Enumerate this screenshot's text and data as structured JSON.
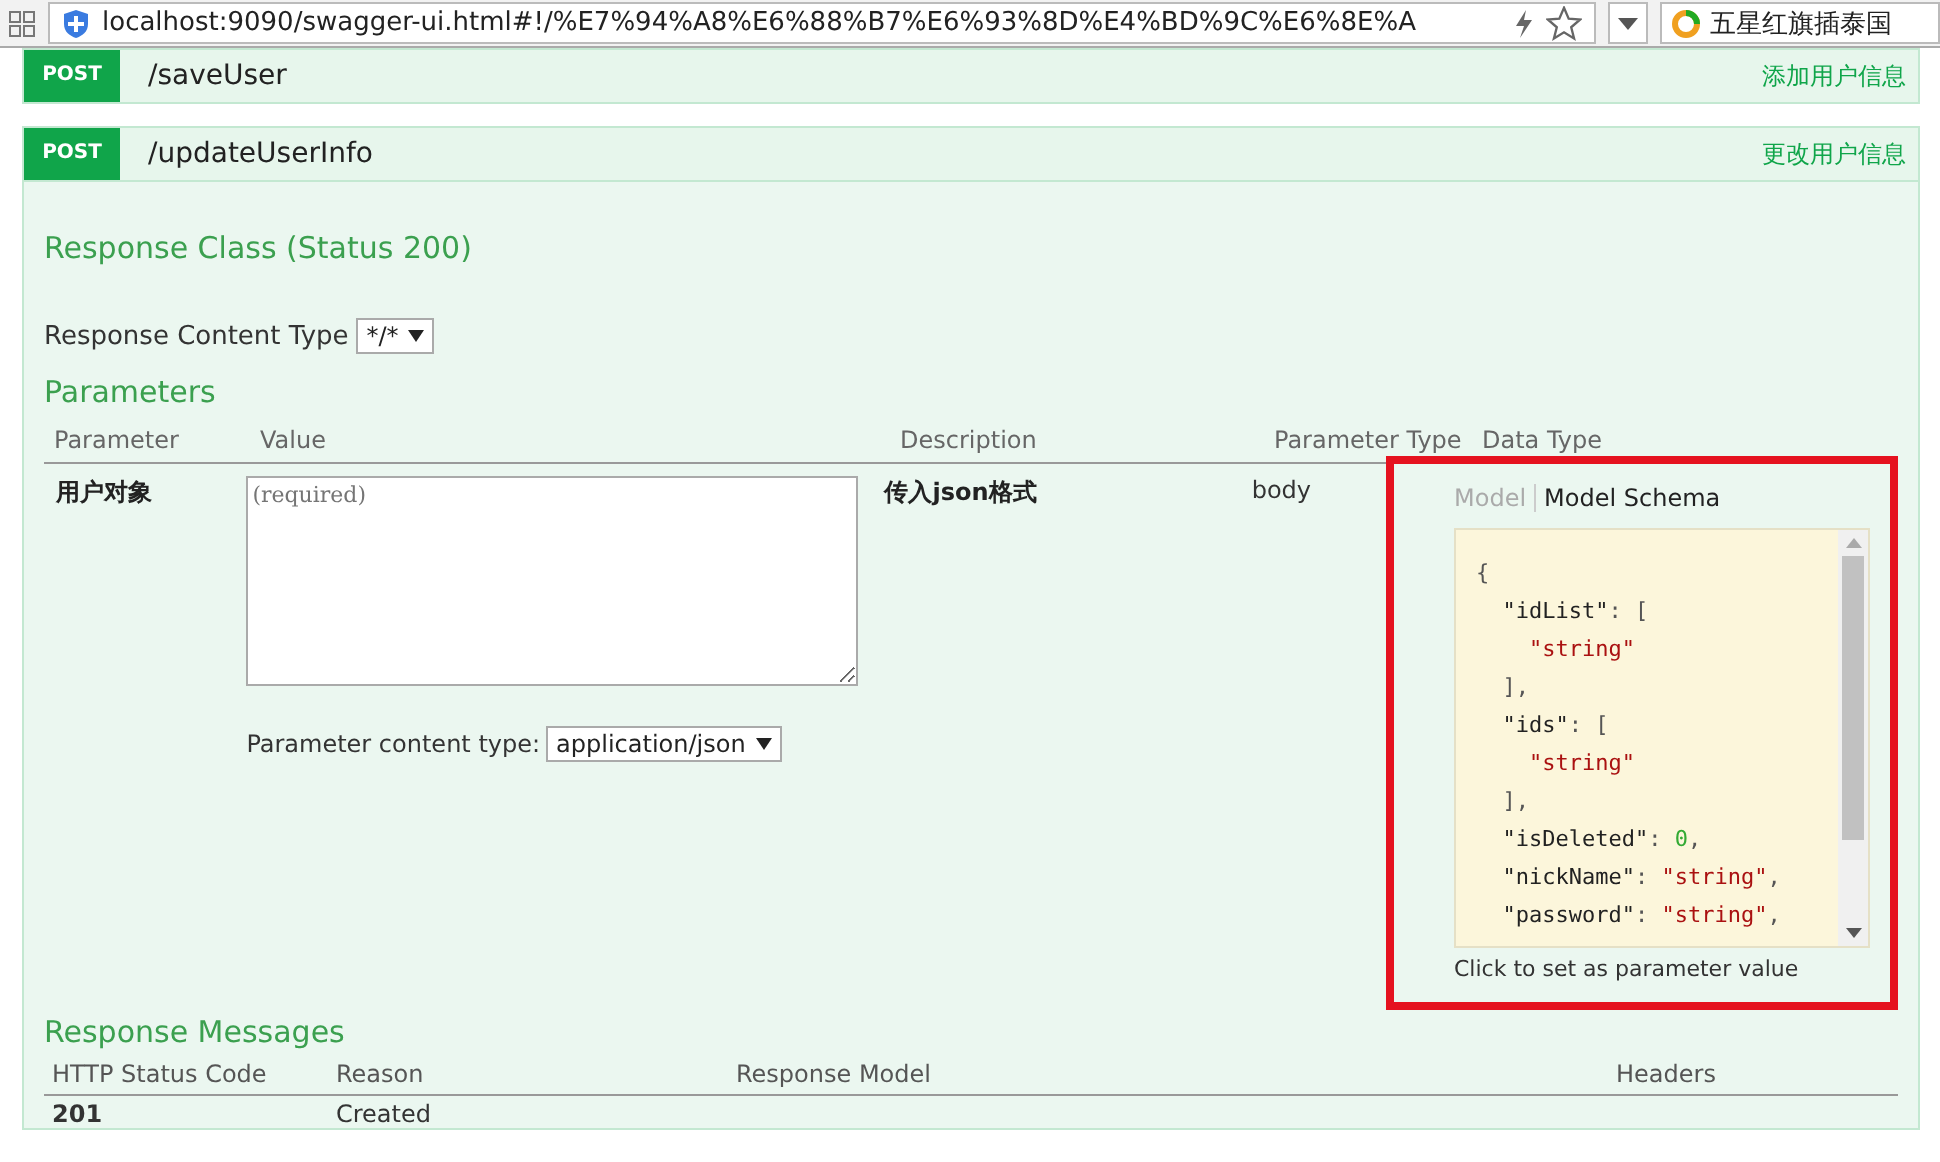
{
  "address_bar": {
    "url": "localhost:9090/swagger-ui.html#!/%E7%94%A8%E6%88%B7%E6%93%8D%E4%BD%9C%E6%8E%A",
    "search_text": "五星红旗插泰国"
  },
  "operations": [
    {
      "method": "POST",
      "path": "/saveUser",
      "summary": "添加用户信息",
      "expanded": false
    },
    {
      "method": "POST",
      "path": "/updateUserInfo",
      "summary": "更改用户信息",
      "expanded": true
    }
  ],
  "response_class": {
    "title": "Response Class (Status 200)"
  },
  "response_content_type": {
    "label": "Response Content Type",
    "value": "*/*"
  },
  "parameters": {
    "title": "Parameters",
    "columns": [
      "Parameter",
      "Value",
      "Description",
      "Parameter Type",
      "Data Type"
    ],
    "rows": [
      {
        "name": "用户对象",
        "placeholder": "(required)",
        "content_type_label": "Parameter content type:",
        "content_type": "application/json",
        "description": "传入json格式",
        "parameter_type": "body",
        "model_tabs": [
          {
            "label": "Model",
            "selected": false
          },
          {
            "label": "Model Schema",
            "selected": true
          }
        ],
        "schema_lines": [
          {
            "tokens": [
              {
                "kind": "punct",
                "text": "{"
              }
            ],
            "children": [
              {
                "tokens": [
                  {
                    "kind": "key",
                    "text": "\"idList\""
                  },
                  {
                    "kind": "punct",
                    "text": ": ["
                  }
                ],
                "children": [
                  {
                    "tokens": [
                      {
                        "kind": "string",
                        "text": "\"string\""
                      }
                    ]
                  }
                ]
              },
              {
                "tokens": [
                  {
                    "kind": "punct",
                    "text": "],"
                  }
                ]
              },
              {
                "tokens": [
                  {
                    "kind": "key",
                    "text": "\"ids\""
                  },
                  {
                    "kind": "punct",
                    "text": ": ["
                  }
                ],
                "children": [
                  {
                    "tokens": [
                      {
                        "kind": "string",
                        "text": "\"string\""
                      }
                    ]
                  }
                ]
              },
              {
                "tokens": [
                  {
                    "kind": "punct",
                    "text": "],"
                  }
                ]
              },
              {
                "tokens": [
                  {
                    "kind": "key",
                    "text": "\"isDeleted\""
                  },
                  {
                    "kind": "punct",
                    "text": ": "
                  },
                  {
                    "kind": "number",
                    "text": "0"
                  },
                  {
                    "kind": "punct",
                    "text": ","
                  }
                ]
              },
              {
                "tokens": [
                  {
                    "kind": "key",
                    "text": "\"nickName\""
                  },
                  {
                    "kind": "punct",
                    "text": ": "
                  },
                  {
                    "kind": "string",
                    "text": "\"string\""
                  },
                  {
                    "kind": "punct",
                    "text": ","
                  }
                ]
              },
              {
                "tokens": [
                  {
                    "kind": "key",
                    "text": "\"password\""
                  },
                  {
                    "kind": "punct",
                    "text": ": "
                  },
                  {
                    "kind": "string",
                    "text": "\"string\""
                  },
                  {
                    "kind": "punct",
                    "text": ","
                  }
                ]
              }
            ]
          }
        ],
        "hint": "Click to set as parameter value",
        "highlighted": true
      }
    ]
  },
  "response_messages": {
    "title": "Response Messages",
    "columns": [
      "HTTP Status Code",
      "Reason",
      "Response Model",
      "Headers"
    ],
    "rows": [
      [
        "201",
        "Created",
        "",
        ""
      ]
    ]
  }
}
